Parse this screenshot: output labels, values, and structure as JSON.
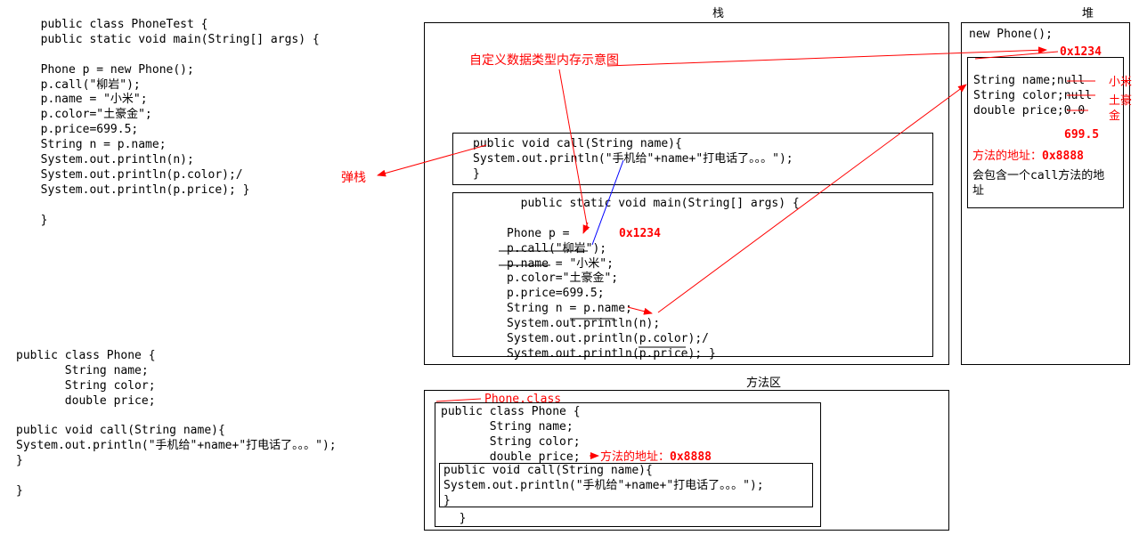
{
  "labels": {
    "stack": "栈",
    "heap": "堆",
    "methodArea": "方法区",
    "popStack": "弹栈",
    "title": "自定义数据类型内存示意图",
    "addr1234": "0x1234",
    "methodAddrLabel": "方法的地址：",
    "methodAddrValue": "0x8888",
    "methodAddrLabel2": "方法的地址：",
    "methodAddrValue2": "0x8888",
    "phoneClass": "Phone.class",
    "callAddrNote": "会包含一个call方法的地址",
    "xiaomi": "小米",
    "tuhaojin": "土豪金",
    "price6995": "699.5"
  },
  "code": {
    "phoneTest": "  public class PhoneTest {\n  public static void main(String[] args) {\n\n  Phone p = new Phone();\n  p.call(\"柳岩\");\n  p.name = \"小米\";\n  p.color=\"土豪金\";\n  p.price=699.5;\n  String n = p.name;\n  System.out.println(n);\n  System.out.println(p.color);/\n  System.out.println(p.price); }\n\n  }",
    "phoneClass": "public class Phone {\n       String name;\n       String color;\n       double price;\n\npublic void call(String name){\nSystem.out.println(\"手机给\"+name+\"打电话了。。。\");\n}\n\n}",
    "callMethod": "public void call(String name){\nSystem.out.println(\"手机给\"+name+\"打电话了。。。\");\n}",
    "mainFrame": "  public static void main(String[] args) {\n\nPhone p =\np.call(\"柳岩\");\np.name = \"小米\";\np.color=\"土豪金\";\np.price=699.5;\nString n = p.name;\nSystem.out.println(n);\nSystem.out.println(p.color);/\nSystem.out.println(p.price); }",
    "newPhone": "new Phone();",
    "heapFields": "String name;null\nString color;null\ndouble price;0.0",
    "methodAreaPhone": "public class Phone {\n       String name;\n       String color;\n       double price;",
    "methodAreaCall": "public void call(String name){\nSystem.out.println(\"手机给\"+name+\"打电话了。。。\");\n}",
    "methodAreaClose": "  }"
  }
}
